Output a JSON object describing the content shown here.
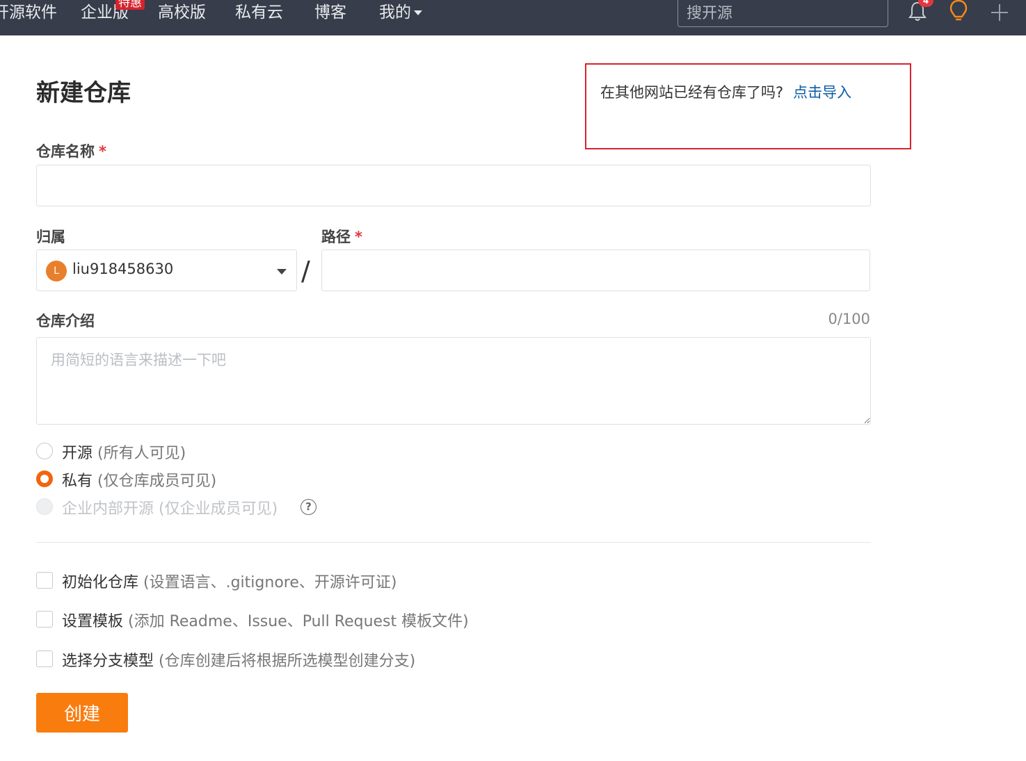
{
  "nav": {
    "items": [
      {
        "label": "开源软件"
      },
      {
        "label": "企业版",
        "badge": "特惠"
      },
      {
        "label": "高校版"
      },
      {
        "label": "私有云"
      },
      {
        "label": "博客"
      },
      {
        "label": "我的"
      }
    ],
    "search_placeholder": "搜开源",
    "notifications_count": "4",
    "icons": [
      "bell-icon",
      "lightbulb-icon",
      "plus-icon"
    ]
  },
  "page": {
    "title": "新建仓库"
  },
  "import": {
    "question": "在其他网站已经有仓库了吗?",
    "link": "点击导入"
  },
  "form": {
    "name_label": "仓库名称",
    "name_value": "",
    "required_mark": "*",
    "owner_label": "归属",
    "owner_avatar": "L",
    "owner_value": "liu918458630",
    "separator": "/",
    "path_label": "路径",
    "path_value": "",
    "desc_label": "仓库介绍",
    "desc_counter": "0/100",
    "desc_placeholder": "用简短的语言来描述一下吧"
  },
  "visibility": [
    {
      "label": "开源",
      "sub": "(所有人可见)",
      "selected": false,
      "disabled": false
    },
    {
      "label": "私有",
      "sub": "(仅仓库成员可见)",
      "selected": true,
      "disabled": false
    },
    {
      "label": "企业内部开源",
      "sub": "(仅企业成员可见)",
      "selected": false,
      "disabled": true
    }
  ],
  "help_glyph": "?",
  "options": [
    {
      "label": "初始化仓库",
      "sub": "(设置语言、.gitignore、开源许可证)",
      "checked": false
    },
    {
      "label": "设置模板",
      "sub": "(添加 Readme、Issue、Pull Request 模板文件)",
      "checked": false
    },
    {
      "label": "选择分支模型",
      "sub": "(仓库创建后将根据所选模型创建分支)",
      "checked": false
    }
  ],
  "submit_label": "创建",
  "colors": {
    "nav_bg": "#373d4a",
    "accent": "#f97c0e",
    "link": "#0a5ea8",
    "highlight_border": "#d9212d"
  }
}
